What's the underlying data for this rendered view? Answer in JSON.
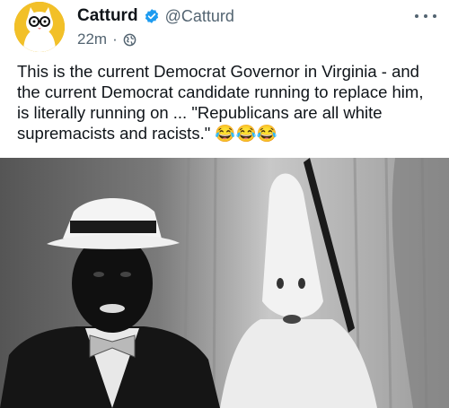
{
  "post": {
    "author": {
      "display_name": "Catturd",
      "handle": "@Catturd",
      "verified": true,
      "avatar_icon": "cat-with-glasses-avatar"
    },
    "meta": {
      "time": "22m",
      "separator": "·",
      "visibility_icon": "globe-icon"
    },
    "more_icon": "more-horizontal-icon",
    "text_lines": [
      "This is the current Democrat Governor in Virginia - and",
      "the current Democrat candidate running to replace him,",
      "is literally running on ... \"Republicans are all white",
      "supremacists and racists.\" 😂😂😂"
    ],
    "image": {
      "kind": "black-and-white photograph",
      "tone": "grayscale"
    }
  },
  "colors": {
    "text_primary": "#0f1419",
    "text_secondary": "#536471",
    "verified_badge": "#1d9bf0",
    "avatar_background": "#f2c028"
  }
}
